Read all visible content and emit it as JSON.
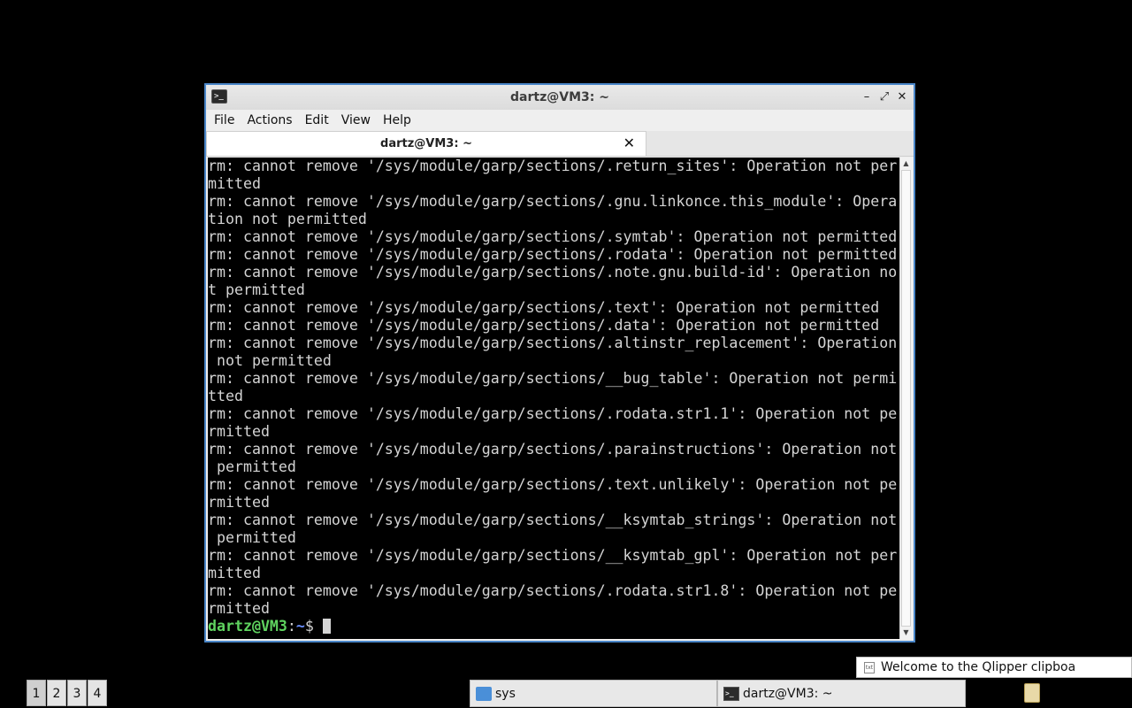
{
  "window": {
    "title": "dartz@VM3: ~",
    "controls": {
      "minimize": "–",
      "maximize": "⤢",
      "close": "✕"
    }
  },
  "menu": [
    "File",
    "Actions",
    "Edit",
    "View",
    "Help"
  ],
  "tab": {
    "label": "dartz@VM3: ~",
    "close": "✕"
  },
  "terminal": {
    "lines": [
      "rm: cannot remove '/sys/module/garp/sections/.return_sites': Operation not per",
      "mitted",
      "rm: cannot remove '/sys/module/garp/sections/.gnu.linkonce.this_module': Opera",
      "tion not permitted",
      "rm: cannot remove '/sys/module/garp/sections/.symtab': Operation not permitted",
      "rm: cannot remove '/sys/module/garp/sections/.rodata': Operation not permitted",
      "rm: cannot remove '/sys/module/garp/sections/.note.gnu.build-id': Operation no",
      "t permitted",
      "rm: cannot remove '/sys/module/garp/sections/.text': Operation not permitted",
      "rm: cannot remove '/sys/module/garp/sections/.data': Operation not permitted",
      "rm: cannot remove '/sys/module/garp/sections/.altinstr_replacement': Operation",
      " not permitted",
      "rm: cannot remove '/sys/module/garp/sections/__bug_table': Operation not permi",
      "tted",
      "rm: cannot remove '/sys/module/garp/sections/.rodata.str1.1': Operation not pe",
      "rmitted",
      "rm: cannot remove '/sys/module/garp/sections/.parainstructions': Operation not",
      " permitted",
      "rm: cannot remove '/sys/module/garp/sections/.text.unlikely': Operation not pe",
      "rmitted",
      "rm: cannot remove '/sys/module/garp/sections/__ksymtab_strings': Operation not",
      " permitted",
      "rm: cannot remove '/sys/module/garp/sections/__ksymtab_gpl': Operation not per",
      "mitted",
      "rm: cannot remove '/sys/module/garp/sections/.rodata.str1.8': Operation not pe",
      "rmitted"
    ],
    "prompt": {
      "user_host": "dartz@VM3",
      "sep": ":",
      "path": "~",
      "symbol": "$ "
    }
  },
  "notification": {
    "text": "Welcome to the Qlipper clipboa",
    "icon": "txt"
  },
  "taskbar": {
    "desktops": [
      "1",
      "2",
      "3",
      "4"
    ],
    "tasks": [
      {
        "label": "sys",
        "icon": "folder-icon"
      },
      {
        "label": "dartz@VM3: ~",
        "icon": "terminal-icon"
      }
    ]
  },
  "colors": {
    "prompt_user": "#5fd35f",
    "prompt_path": "#6b8fff",
    "window_border": "#4a86c8"
  }
}
